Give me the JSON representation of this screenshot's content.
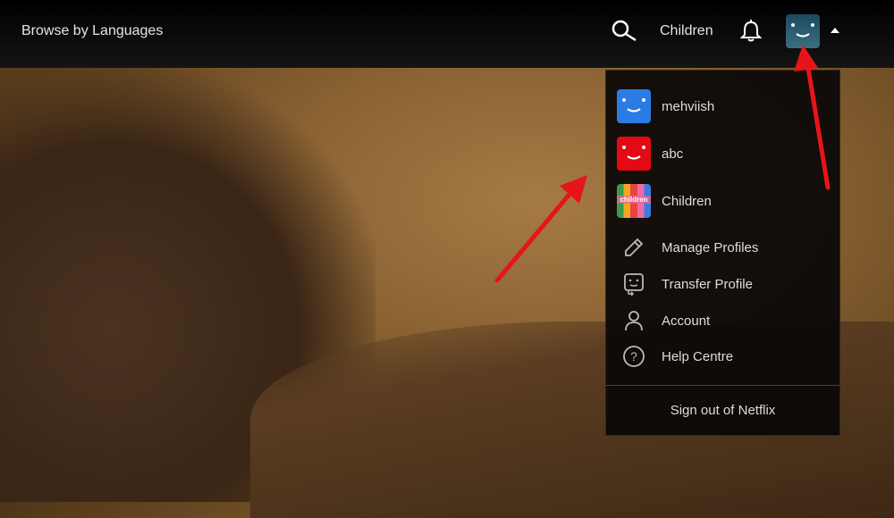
{
  "header": {
    "nav_label": "Browse by Languages",
    "kids_label": "Children",
    "icons": [
      "search-icon",
      "bell-icon",
      "profile-avatar",
      "caret-up-icon"
    ]
  },
  "menu": {
    "profiles": [
      {
        "name": "mehviish",
        "color": "#2a7be4"
      },
      {
        "name": "abc",
        "color": "#e50914"
      },
      {
        "name": "Children",
        "color": "#f06"
      }
    ],
    "children_avatar_text": "children",
    "items": [
      {
        "label": "Manage Profiles",
        "icon": "pencil-icon"
      },
      {
        "label": "Transfer Profile",
        "icon": "transfer-profile-icon"
      },
      {
        "label": "Account",
        "icon": "person-icon"
      },
      {
        "label": "Help Centre",
        "icon": "help-icon"
      }
    ],
    "sign_out": "Sign out of Netflix"
  },
  "colors": {
    "annotation_arrow": "#e8141b"
  }
}
